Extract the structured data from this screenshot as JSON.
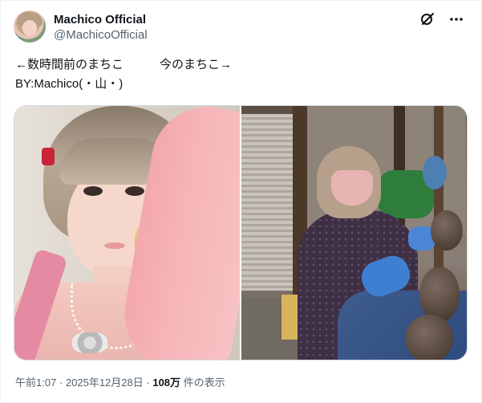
{
  "author": {
    "display_name": "Machico Official",
    "handle": "@MachicoOfficial",
    "avatar_icon": "avatar-photo"
  },
  "header_icons": [
    "grok-icon",
    "more-icon"
  ],
  "tweet": {
    "line1": "←数時間前のまちこ　　　今のまちこ→",
    "line2": "BY:Machico(・山・)"
  },
  "media": {
    "left_photo": "selfie-photo",
    "right_photo": "warehouse-photo"
  },
  "meta": {
    "time": "午前1:07",
    "date": "2025年12月28日",
    "views": "108万",
    "views_label": "件の表示",
    "separator": "·"
  },
  "colors": {
    "text": "#0f1419",
    "secondary": "#536471",
    "border": "#cfd9de"
  }
}
